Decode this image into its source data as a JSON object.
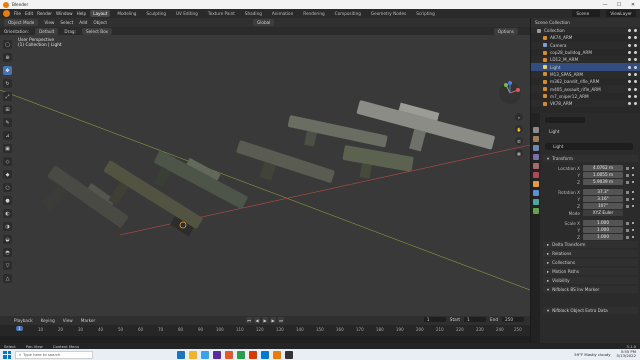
{
  "titlebar": {
    "title": "Blender"
  },
  "menubar": {
    "menus": [
      "File",
      "Edit",
      "Render",
      "Window",
      "Help"
    ],
    "workspaces": [
      "Layout",
      "Modeling",
      "Sculpting",
      "UV Editing",
      "Texture Paint",
      "Shading",
      "Animation",
      "Rendering",
      "Compositing",
      "Geometry Nodes",
      "Scripting"
    ],
    "active_workspace": "Layout",
    "scene": "Scene",
    "view_layer": "ViewLayer"
  },
  "viewport_header": {
    "mode": "Object Mode",
    "menus": [
      "View",
      "Select",
      "Add",
      "Object"
    ],
    "transform_orientation": "Global"
  },
  "tool_settings": {
    "orientation_label": "Orientation:",
    "orientation_value": "Default",
    "drag_label": "Drag:",
    "drag_value": "Select Box",
    "options_label": "Options"
  },
  "viewport": {
    "view_name": "User Perspective",
    "collection_info": "(1) Collection | Light"
  },
  "outliner": {
    "header": "Scene Collection",
    "items": [
      {
        "label": "Collection",
        "color": "#9a9a9a",
        "selected": false
      },
      {
        "label": "AK74_ARM",
        "color": "#d98c2e",
        "selected": false
      },
      {
        "label": "Camera",
        "color": "#7c9fd6",
        "selected": false
      },
      {
        "label": "cop28_bulldog_ARM",
        "color": "#d98c2e",
        "selected": false
      },
      {
        "label": "LD12_M_ARM",
        "color": "#d98c2e",
        "selected": false
      },
      {
        "label": "Light",
        "color": "#e6d36a",
        "selected": true
      },
      {
        "label": "M13_SPAS_ARM",
        "color": "#d98c2e",
        "selected": false
      },
      {
        "label": "m362_bandit_rifle_ARM",
        "color": "#d98c2e",
        "selected": false
      },
      {
        "label": "m405_assault_rifle_ARM",
        "color": "#d98c2e",
        "selected": false
      },
      {
        "label": "m7_sniper12_ARM",
        "color": "#d98c2e",
        "selected": false
      },
      {
        "label": "VK78_ARM",
        "color": "#d98c2e",
        "selected": false
      }
    ]
  },
  "properties": {
    "object_name": "Light",
    "name_field": "Light",
    "sections": {
      "transform": "Transform",
      "delta_transform": "Delta Transform",
      "relations": "Relations",
      "collections": "Collections",
      "motion_paths": "Motion Paths",
      "visibility": "Visibility",
      "nifblock": "Nifblock BS Inv Marker",
      "extra_data": "Nifblock Object Extra Data"
    },
    "location": {
      "label": "Location X",
      "x": "4.0762 m",
      "y": "1.0055 m",
      "z": "5.9039 m"
    },
    "rotation": {
      "label": "Rotation X",
      "x": "37.3°",
      "y": "3.16°",
      "z": "107°"
    },
    "mode": {
      "label": "Mode",
      "value": "XYZ Euler"
    },
    "scale": {
      "label": "Scale X",
      "x": "1.000",
      "y": "1.000",
      "z": "1.000"
    },
    "axis_labels": {
      "y": "Y",
      "z": "Z"
    }
  },
  "timeline": {
    "menus": [
      "Playback",
      "Keying",
      "View",
      "Marker"
    ],
    "current_frame": "1",
    "start_label": "Start",
    "start": "1",
    "end_label": "End",
    "end": "250",
    "ruler": [
      "1",
      "10",
      "20",
      "30",
      "40",
      "50",
      "60",
      "70",
      "80",
      "90",
      "100",
      "110",
      "120",
      "130",
      "140",
      "150",
      "160",
      "170",
      "180",
      "190",
      "200",
      "210",
      "220",
      "230",
      "240",
      "250"
    ]
  },
  "statusbar": {
    "select": "Select",
    "pan": "Pan View",
    "context": "Context Menu",
    "version": "3.1.0"
  },
  "taskbar": {
    "search_placeholder": "Type here to search",
    "weather": "59°F  Mostly cloudy",
    "time": "5:55 PM",
    "date": "5/13/2022",
    "apps": [
      "#1e73be",
      "#f0b429",
      "#3aa0e8",
      "#5a2ca0",
      "#e05a2b",
      "#2a9d4b",
      "#d83b01",
      "#0078d4",
      "#e87d0d",
      "#333333"
    ]
  },
  "icons": {
    "search": "search-icon",
    "close": "close-icon",
    "minimize": "minimize-icon",
    "maximize": "maximize-icon"
  }
}
